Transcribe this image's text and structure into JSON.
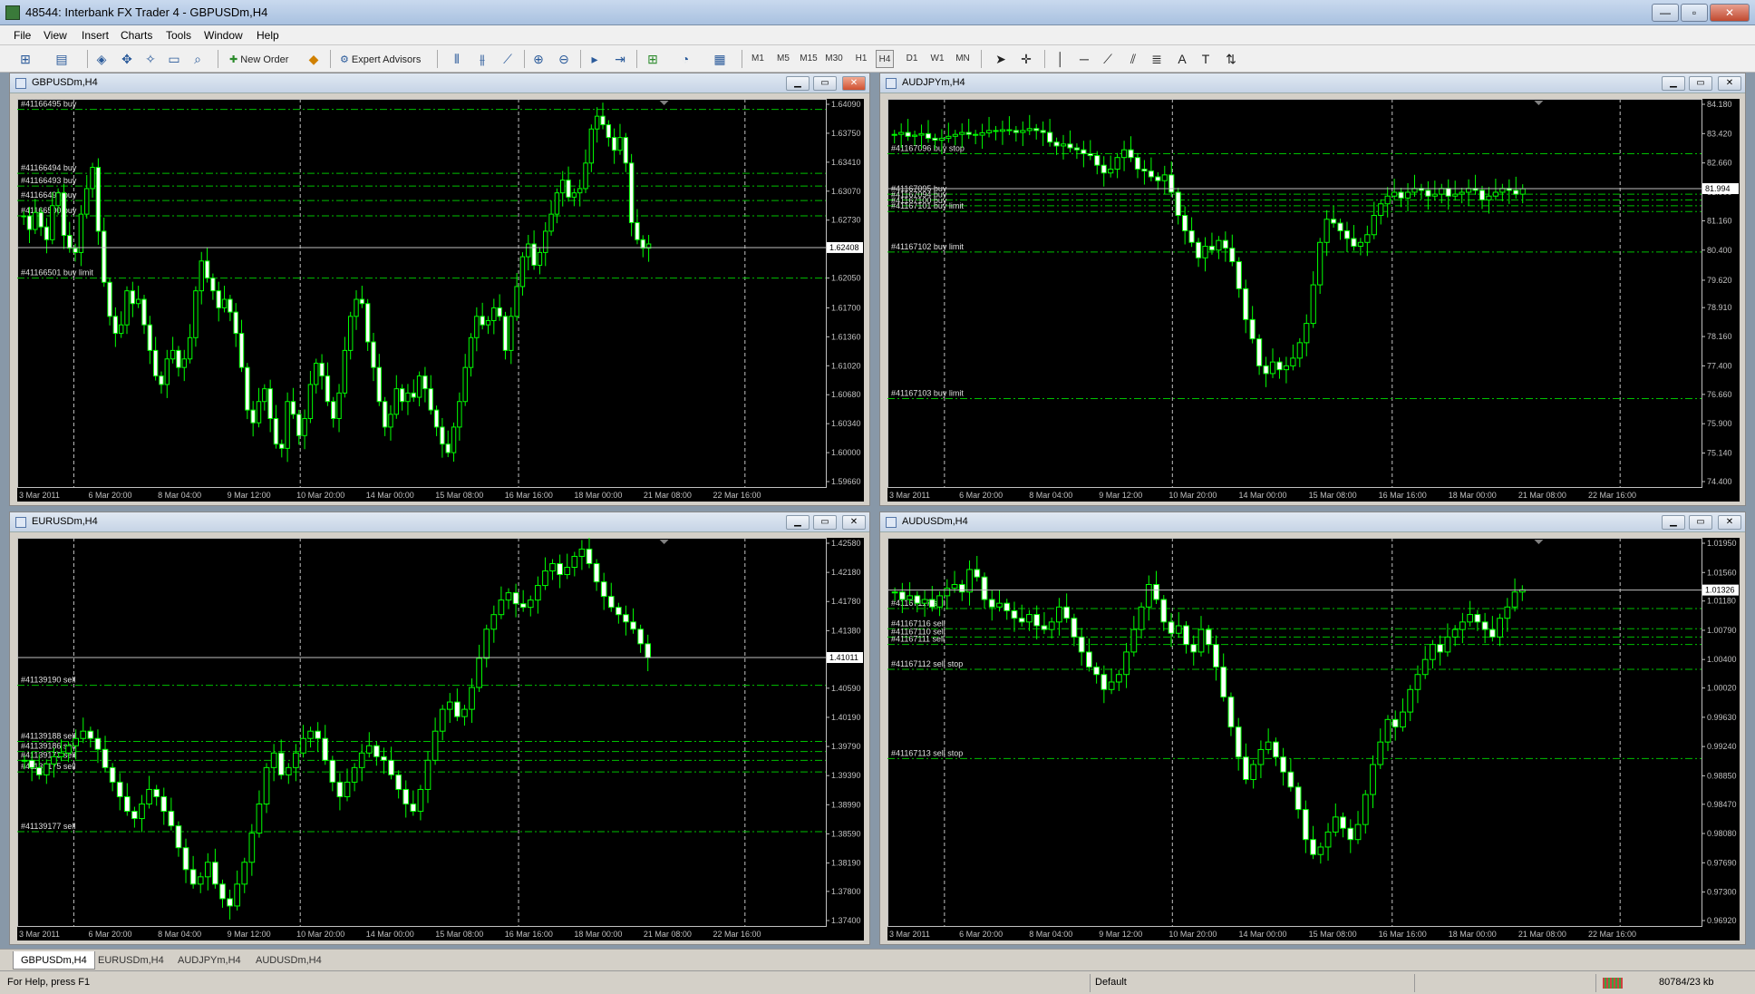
{
  "app": {
    "title": "48544: Interbank FX Trader 4 - GBPUSDm,H4"
  },
  "window_controls": {
    "minimize": "—",
    "maximize": "▫",
    "close": "✕"
  },
  "menu": [
    "File",
    "View",
    "Insert",
    "Charts",
    "Tools",
    "Window",
    "Help"
  ],
  "toolbar": {
    "new_order": "New Order",
    "expert_advisors": "Expert Advisors",
    "timeframes": [
      "M1",
      "M5",
      "M15",
      "M30",
      "H1",
      "H4",
      "D1",
      "W1",
      "MN"
    ]
  },
  "charts": [
    {
      "title": "GBPUSDm,H4",
      "current_price": "1.62408",
      "y_ticks": [
        "1.64090",
        "1.63750",
        "1.63410",
        "1.63070",
        "1.62730",
        "1.62400",
        "1.62050",
        "1.61700",
        "1.61360",
        "1.61020",
        "1.60680",
        "1.60340",
        "1.60000",
        "1.59660"
      ],
      "x_ticks": [
        "3 Mar 2011",
        "6 Mar 20:00",
        "8 Mar 04:00",
        "9 Mar 12:00",
        "10 Mar 20:00",
        "14 Mar 00:00",
        "15 Mar 08:00",
        "16 Mar 16:00",
        "18 Mar 00:00",
        "21 Mar 08:00",
        "22 Mar 16:00"
      ],
      "orders": [
        {
          "label": "#41166495 buy",
          "price": 1.6403
        },
        {
          "label": "#41166494 buy",
          "price": 1.6328
        },
        {
          "label": "#41166493 buy",
          "price": 1.6313
        },
        {
          "label": "#41166499 buy",
          "price": 1.6296
        },
        {
          "label": "#41166500 buy",
          "price": 1.6278
        },
        {
          "label": "#41166501 buy limit",
          "price": 1.6205
        }
      ],
      "closes": [
        1.6278,
        1.6262,
        1.6282,
        1.6265,
        1.625,
        1.629,
        1.6305,
        1.6255,
        1.624,
        1.6235,
        1.628,
        1.631,
        1.6335,
        1.626,
        1.62,
        1.616,
        1.614,
        1.615,
        1.619,
        1.6175,
        1.618,
        1.615,
        1.612,
        1.609,
        1.608,
        1.611,
        1.612,
        1.61,
        1.611,
        1.6135,
        1.619,
        1.6225,
        1.6205,
        1.619,
        1.617,
        1.618,
        1.6165,
        1.614,
        1.61,
        1.605,
        1.6035,
        1.606,
        1.6075,
        1.604,
        1.601,
        1.6005,
        1.606,
        1.6045,
        1.602,
        1.604,
        1.608,
        1.6105,
        1.609,
        1.606,
        1.604,
        1.607,
        1.612,
        1.616,
        1.618,
        1.6175,
        1.613,
        1.61,
        1.606,
        1.603,
        1.6045,
        1.6075,
        1.606,
        1.607,
        1.6065,
        1.609,
        1.6075,
        1.605,
        1.603,
        1.601,
        1.6,
        1.603,
        1.606,
        1.61,
        1.6135,
        1.616,
        1.615,
        1.6155,
        1.617,
        1.616,
        1.612,
        1.616,
        1.6195,
        1.623,
        1.6245,
        1.622,
        1.6235,
        1.626,
        1.628,
        1.6305,
        1.632,
        1.63,
        1.6305,
        1.631,
        1.634,
        1.638,
        1.6395,
        1.6385,
        1.637,
        1.6355,
        1.637,
        1.634,
        1.627,
        1.625,
        1.624,
        1.6245
      ]
    },
    {
      "title": "AUDJPYm,H4",
      "current_price": "81.994",
      "y_ticks": [
        "84.180",
        "83.420",
        "82.660",
        "81.900",
        "81.160",
        "80.400",
        "79.620",
        "78.910",
        "78.160",
        "77.400",
        "76.660",
        "75.900",
        "75.140",
        "74.400"
      ],
      "x_ticks": [
        "3 Mar 2011",
        "6 Mar 20:00",
        "8 Mar 04:00",
        "9 Mar 12:00",
        "10 Mar 20:00",
        "14 Mar 00:00",
        "15 Mar 08:00",
        "16 Mar 16:00",
        "18 Mar 00:00",
        "21 Mar 08:00",
        "22 Mar 16:00"
      ],
      "orders": [
        {
          "label": "#41167096 buy stop",
          "price": 82.9
        },
        {
          "label": "#41167095 buy",
          "price": 81.85
        },
        {
          "label": "#41167094 buy",
          "price": 81.7
        },
        {
          "label": "#41167100 buy",
          "price": 81.55
        },
        {
          "label": "#41167101 buy limit",
          "price": 81.4
        },
        {
          "label": "#41167102 buy limit",
          "price": 80.35
        },
        {
          "label": "#41167103 buy limit",
          "price": 76.55
        }
      ],
      "closes": [
        83.4,
        83.45,
        83.35,
        83.38,
        83.42,
        83.3,
        83.25,
        83.3,
        83.35,
        83.4,
        83.45,
        83.4,
        83.38,
        83.44,
        83.5,
        83.48,
        83.52,
        83.5,
        83.45,
        83.5,
        83.55,
        83.5,
        83.45,
        83.2,
        83.1,
        83.15,
        83.05,
        83.0,
        82.9,
        82.85,
        82.6,
        82.4,
        82.5,
        82.8,
        83.0,
        82.8,
        82.5,
        82.45,
        82.3,
        82.2,
        82.35,
        81.9,
        81.3,
        80.9,
        80.6,
        80.2,
        80.5,
        80.4,
        80.65,
        80.45,
        80.1,
        79.4,
        78.6,
        78.1,
        77.4,
        77.2,
        77.5,
        77.3,
        77.4,
        77.6,
        78.0,
        78.5,
        79.5,
        80.6,
        81.2,
        81.1,
        80.9,
        80.7,
        80.5,
        80.6,
        80.8,
        81.3,
        81.6,
        81.8,
        81.9,
        81.75,
        81.9,
        82.0,
        81.95,
        81.8,
        81.85,
        82.0,
        81.8,
        81.85,
        81.9,
        82.0,
        81.95,
        81.7,
        81.8,
        81.9,
        82.0,
        81.95,
        81.85,
        81.99
      ]
    },
    {
      "title": "EURUSDm,H4",
      "current_price": "1.41011",
      "y_ticks": [
        "1.42580",
        "1.42180",
        "1.41780",
        "1.41380",
        "1.40980",
        "1.40590",
        "1.40190",
        "1.39790",
        "1.39390",
        "1.38990",
        "1.38590",
        "1.38190",
        "1.37800",
        "1.37400"
      ],
      "x_ticks": [
        "3 Mar 2011",
        "6 Mar 20:00",
        "8 Mar 04:00",
        "9 Mar 12:00",
        "10 Mar 20:00",
        "14 Mar 00:00",
        "15 Mar 08:00",
        "16 Mar 16:00",
        "18 Mar 00:00",
        "21 Mar 08:00",
        "22 Mar 16:00"
      ],
      "orders": [
        {
          "label": "#41139190 sell",
          "price": 1.4063
        },
        {
          "label": "#41139188 sell",
          "price": 1.3986
        },
        {
          "label": "#41139186 sell",
          "price": 1.3972
        },
        {
          "label": "#41139173 sell",
          "price": 1.396
        },
        {
          "label": "#41139175 sell",
          "price": 1.3944
        },
        {
          "label": "#41139177 sell",
          "price": 1.3862
        }
      ],
      "closes": [
        1.396,
        1.395,
        1.394,
        1.3955,
        1.3965,
        1.397,
        1.398,
        1.399,
        1.4,
        1.399,
        1.3975,
        1.395,
        1.393,
        1.391,
        1.389,
        1.388,
        1.39,
        1.392,
        1.391,
        1.389,
        1.387,
        1.384,
        1.381,
        1.379,
        1.38,
        1.382,
        1.379,
        1.377,
        1.376,
        1.379,
        1.382,
        1.386,
        1.39,
        1.395,
        1.397,
        1.394,
        1.395,
        1.397,
        1.399,
        1.4,
        1.399,
        1.396,
        1.393,
        1.391,
        1.393,
        1.395,
        1.397,
        1.398,
        1.3965,
        1.396,
        1.394,
        1.392,
        1.39,
        1.389,
        1.392,
        1.396,
        1.4,
        1.403,
        1.404,
        1.402,
        1.403,
        1.406,
        1.41,
        1.414,
        1.416,
        1.418,
        1.419,
        1.4175,
        1.417,
        1.418,
        1.42,
        1.422,
        1.423,
        1.4215,
        1.4225,
        1.424,
        1.425,
        1.423,
        1.4205,
        1.4185,
        1.417,
        1.416,
        1.415,
        1.414,
        1.412,
        1.4101
      ]
    },
    {
      "title": "AUDUSDm,H4",
      "current_price": "1.01326",
      "y_ticks": [
        "1.01950",
        "1.01560",
        "1.01180",
        "1.00790",
        "1.00400",
        "1.00020",
        "0.99630",
        "0.99240",
        "0.98850",
        "0.98470",
        "0.98080",
        "0.97690",
        "0.97300",
        "0.96920"
      ],
      "x_ticks": [
        "3 Mar 2011",
        "6 Mar 20:00",
        "8 Mar 04:00",
        "9 Mar 12:00",
        "10 Mar 20:00",
        "14 Mar 00:00",
        "15 Mar 08:00",
        "16 Mar 16:00",
        "18 Mar 00:00",
        "21 Mar 08:00",
        "22 Mar 16:00"
      ],
      "orders": [
        {
          "label": "#41167117 sell",
          "price": 1.0108
        },
        {
          "label": "#41167116 sell",
          "price": 1.0081
        },
        {
          "label": "#41167110 sell",
          "price": 1.007
        },
        {
          "label": "#41167111 sell",
          "price": 1.006
        },
        {
          "label": "#41167112 sell stop",
          "price": 1.0027
        },
        {
          "label": "#41167113 sell stop",
          "price": 0.9908
        }
      ],
      "closes": [
        1.013,
        1.012,
        1.0125,
        1.0115,
        1.012,
        1.011,
        1.0125,
        1.0135,
        1.014,
        1.013,
        1.016,
        1.015,
        1.012,
        1.011,
        1.0115,
        1.0105,
        1.0095,
        1.009,
        1.01,
        1.0085,
        1.008,
        1.009,
        1.011,
        1.0095,
        1.007,
        1.005,
        1.003,
        1.002,
        1.0,
        1.001,
        1.002,
        1.005,
        1.008,
        1.011,
        1.014,
        1.012,
        1.009,
        1.0075,
        1.0085,
        1.006,
        1.005,
        1.008,
        1.006,
        1.003,
        0.999,
        0.995,
        0.991,
        0.988,
        0.99,
        0.992,
        0.993,
        0.991,
        0.989,
        0.987,
        0.984,
        0.98,
        0.978,
        0.979,
        0.981,
        0.983,
        0.9815,
        0.98,
        0.982,
        0.986,
        0.99,
        0.993,
        0.996,
        0.995,
        0.997,
        1.0,
        1.002,
        1.004,
        1.006,
        1.005,
        1.007,
        1.008,
        1.009,
        1.01,
        1.009,
        1.008,
        1.007,
        1.0095,
        1.011,
        1.013,
        1.0133
      ]
    }
  ],
  "tabs": [
    "GBPUSDm,H4",
    "EURUSDm,H4",
    "AUDJPYm,H4",
    "AUDUSDm,H4"
  ],
  "status": {
    "help": "For Help, press F1",
    "profile": "Default",
    "traffic": "80784/23 kb"
  },
  "colors": {
    "bull": "#00ff00",
    "bear": "#00ff00",
    "grid": "#c0c0c0",
    "orders": "#00c000",
    "background": "#000000"
  }
}
